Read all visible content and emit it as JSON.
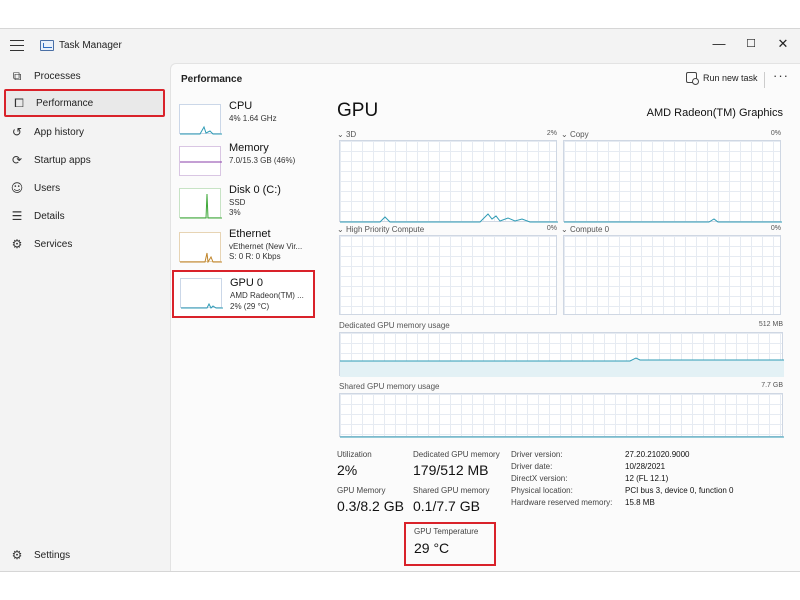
{
  "window": {
    "title": "Task Manager",
    "controls": {
      "minimize": "—",
      "maximize": "☐",
      "close": "✕"
    }
  },
  "sidebar": {
    "items": [
      {
        "label": "Processes",
        "icon": "processes-icon",
        "glyph": "⧉"
      },
      {
        "label": "Performance",
        "icon": "performance-icon",
        "glyph": "⧠"
      },
      {
        "label": "App history",
        "icon": "history-icon",
        "glyph": "↺"
      },
      {
        "label": "Startup apps",
        "icon": "startup-icon",
        "glyph": "⟳"
      },
      {
        "label": "Users",
        "icon": "users-icon",
        "glyph": "☺"
      },
      {
        "label": "Details",
        "icon": "details-icon",
        "glyph": "☰"
      },
      {
        "label": "Services",
        "icon": "services-icon",
        "glyph": "⚙"
      }
    ],
    "settings": {
      "label": "Settings",
      "glyph": "⚙"
    }
  },
  "header": {
    "title": "Performance",
    "run_task": "Run new task",
    "more": "···"
  },
  "perf_list": [
    {
      "name": "CPU",
      "sub1": "4% 1.64 GHz",
      "sub2": ""
    },
    {
      "name": "Memory",
      "sub1": "7.0/15.3 GB (46%)",
      "sub2": ""
    },
    {
      "name": "Disk 0 (C:)",
      "sub1": "SSD",
      "sub2": "3%"
    },
    {
      "name": "Ethernet",
      "sub1": "vEthernet (New Vir...",
      "sub2": "S: 0 R: 0 Kbps"
    },
    {
      "name": "GPU 0",
      "sub1": "AMD Radeon(TM) ...",
      "sub2": "2% (29 °C)"
    }
  ],
  "gpu": {
    "title": "GPU",
    "name": "AMD Radeon(TM) Graphics",
    "engines": [
      {
        "label": "3D",
        "pct": "2%"
      },
      {
        "label": "Copy",
        "pct": "0%"
      },
      {
        "label": "High Priority Compute",
        "pct": "0%"
      },
      {
        "label": "Compute 0",
        "pct": "0%"
      }
    ],
    "dedicated": {
      "label": "Dedicated GPU memory usage",
      "max": "512 MB"
    },
    "shared": {
      "label": "Shared GPU memory usage",
      "max": "7.7 GB"
    },
    "stats": {
      "utilization": {
        "label": "Utilization",
        "value": "2%"
      },
      "dedicated_mem": {
        "label": "Dedicated GPU memory",
        "value": "179/512 MB"
      },
      "gpu_mem": {
        "label": "GPU Memory",
        "value": "0.3/8.2 GB"
      },
      "shared_mem": {
        "label": "Shared GPU memory",
        "value": "0.1/7.7 GB"
      },
      "temperature": {
        "label": "GPU Temperature",
        "value": "29 °C"
      }
    },
    "info": [
      {
        "key": "Driver version:",
        "value": "27.20.21020.9000"
      },
      {
        "key": "Driver date:",
        "value": "10/28/2021"
      },
      {
        "key": "DirectX version:",
        "value": "12 (FL 12.1)"
      },
      {
        "key": "Physical location:",
        "value": "PCI bus 3, device 0, function 0"
      },
      {
        "key": "Hardware reserved memory:",
        "value": "15.8 MB"
      }
    ]
  },
  "colors": {
    "highlight": "#d9222a",
    "gpu_line": "#2e9bb5",
    "mem_line": "#8a3fa8",
    "disk_line": "#3fa83a",
    "eth_line": "#c0852a"
  }
}
